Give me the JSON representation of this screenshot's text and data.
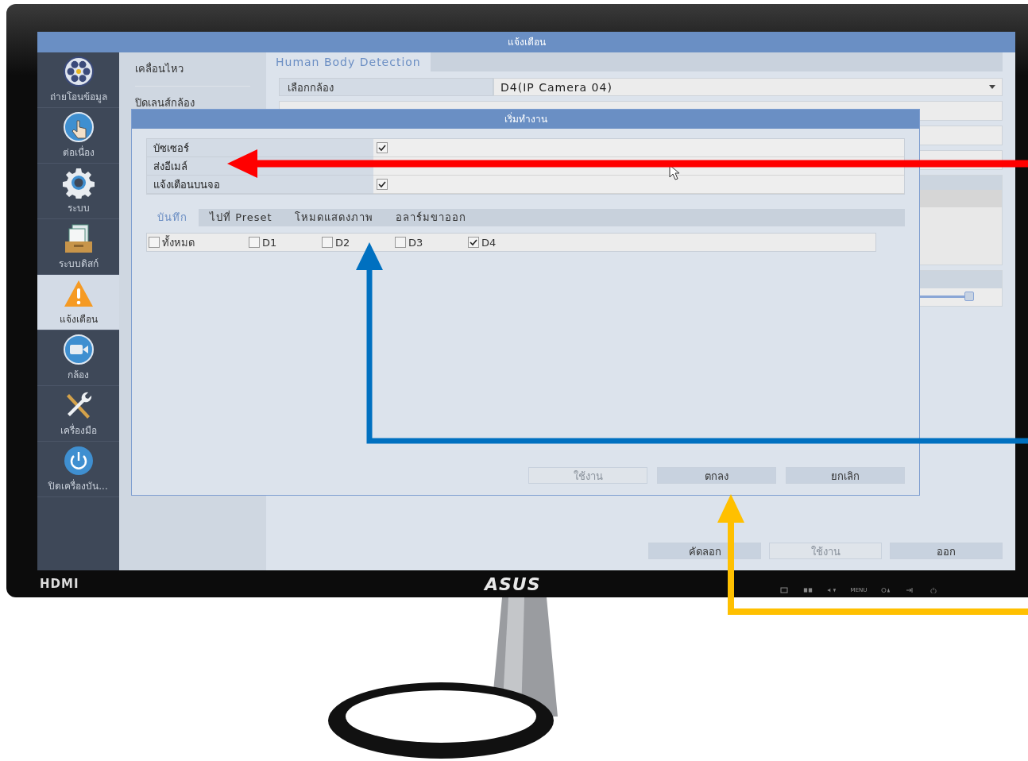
{
  "window": {
    "title": "แจ้งเตือน"
  },
  "nav": [
    {
      "label": "ถ่ายโอนข้อมูล",
      "kind": "film",
      "selected": false
    },
    {
      "label": "ต่อเนื่อง",
      "kind": "touch",
      "selected": false
    },
    {
      "label": "ระบบ",
      "kind": "gear",
      "selected": false
    },
    {
      "label": "ระบบดิสก์",
      "kind": "disk",
      "selected": false
    },
    {
      "label": "แจ้งเตือน",
      "kind": "warning",
      "selected": true
    },
    {
      "label": "กล้อง",
      "kind": "camera",
      "selected": false
    },
    {
      "label": "เครื่องมือ",
      "kind": "tools",
      "selected": false
    },
    {
      "label": "ปิดเครื่องบัน...",
      "kind": "power",
      "selected": false
    }
  ],
  "submenu": [
    {
      "label": "เคลื่อนไหว"
    },
    {
      "label": "ปิดเลนส์กล้อง"
    }
  ],
  "tabs": [
    {
      "label": "Human Body Detection",
      "selected": true
    }
  ],
  "camera_select": {
    "label": "เลือกกล้อง",
    "value": "D4(IP Camera 04)"
  },
  "slider": {
    "level": 0.97
  },
  "buttons": [
    {
      "label": "คัดลอก",
      "disabled": false
    },
    {
      "label": "ใช้งาน",
      "disabled": true
    },
    {
      "label": "ออก",
      "disabled": false
    }
  ],
  "dialog": {
    "title": "เริ่มทำงาน",
    "options": [
      {
        "label": "บัซเซอร์",
        "checked": true
      },
      {
        "label": "ส่งอีเมล์"
      },
      {
        "label": "แจ้งเตือนบนจอ",
        "checked": true
      }
    ],
    "tabs": [
      {
        "label": "บันทึก",
        "selected": true
      },
      {
        "label": "ไปที่ Preset",
        "selected": false
      },
      {
        "label": "โหมดแสดงภาพ",
        "selected": false
      },
      {
        "label": "อลาร์มขาออก",
        "selected": false
      }
    ],
    "channels": [
      {
        "label": "ทั้งหมด",
        "checked": false
      },
      {
        "label": "D1",
        "checked": false
      },
      {
        "label": "D2",
        "checked": false
      },
      {
        "label": "D3",
        "checked": false
      },
      {
        "label": "D4",
        "checked": true
      }
    ],
    "buttons": [
      {
        "label": "ใช้งาน",
        "disabled": true
      },
      {
        "label": "ตกลง",
        "disabled": false
      },
      {
        "label": "ยกเลิก",
        "disabled": false
      }
    ]
  },
  "monitor": {
    "port_label": "HDMI",
    "logo": "ASUS",
    "control_label": "MENU"
  }
}
